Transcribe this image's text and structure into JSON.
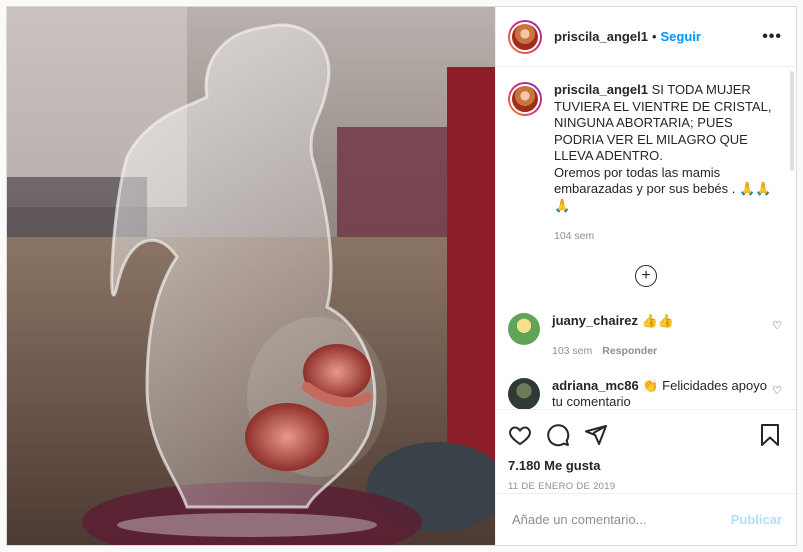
{
  "post": {
    "username": "priscila_angel1",
    "separator": "•",
    "follow_label": "Seguir",
    "more_icon": "more-horizontal-icon",
    "caption": {
      "username": "priscila_angel1",
      "line1": "SI TODA MUJER TUVIERA EL VIENTRE DE CRISTAL, NINGUNA ABORTARIA; PUES PODRIA VER EL MILAGRO QUE LLEVA ADENTRO.",
      "line2": "Oremos por todas las mamis embarazadas y por sus bebés . 🙏🙏🙏",
      "time": "104 sem"
    },
    "comments": [
      {
        "username": "juany_chairez",
        "text": "👍👍",
        "time": "103 sem",
        "reply_label": "Responder"
      },
      {
        "username": "adriana_mc86",
        "text": "👏 Felicidades apoyo tu comentario",
        "time": "",
        "reply_label": ""
      }
    ],
    "likes": "7.180 Me gusta",
    "date": "11 DE ENERO DE 2019",
    "comment_placeholder": "Añade un comentario...",
    "publish_label": "Publicar"
  },
  "colors": {
    "link": "#0095f6",
    "publish_disabled": "#b2dffc",
    "text": "#262626",
    "muted": "#8e8e8e"
  }
}
